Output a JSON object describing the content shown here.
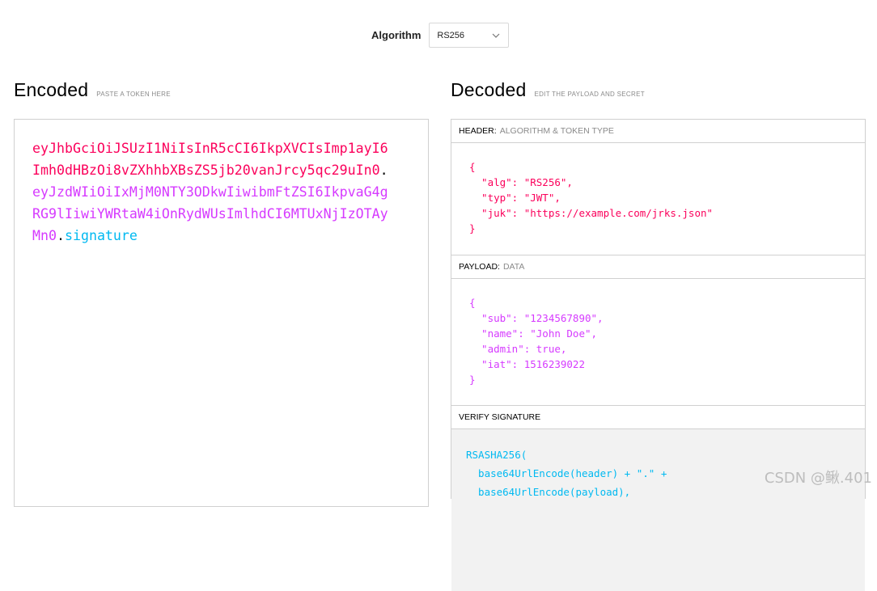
{
  "algorithm": {
    "label": "Algorithm",
    "selected": "RS256"
  },
  "encoded": {
    "title": "Encoded",
    "hint": "PASTE A TOKEN HERE",
    "token_header": "eyJhbGciOiJSUzI1NiIsInR5cCI6IkpXVCIsImp1ayI6Imh0dHBzOi8vZXhhbXBsZS5jb20vanJrcy5qc29uIn0",
    "token_payload": "eyJzdWIiOiIxMjM0NTY3ODkwIiwibmFtZSI6IkpvaG4gRG9lIiwiYWRtaW4iOnRydWUsImlhdCI6MTUxNjIzOTAyMn0",
    "token_signature": "signature",
    "dot": "."
  },
  "decoded": {
    "title": "Decoded",
    "hint": "EDIT THE PAYLOAD AND SECRET",
    "header_panel": {
      "label": "HEADER:",
      "sub": "ALGORITHM & TOKEN TYPE",
      "lines": [
        "{",
        "  \"alg\": \"RS256\",",
        "  \"typ\": \"JWT\",",
        "  \"juk\": \"https://example.com/jrks.json\"",
        "}"
      ]
    },
    "payload_panel": {
      "label": "PAYLOAD:",
      "sub": "DATA",
      "lines": [
        "{",
        "  \"sub\": \"1234567890\",",
        "  \"name\": \"John Doe\",",
        "  \"admin\": true,",
        "  \"iat\": 1516239022",
        "}"
      ]
    },
    "verify_panel": {
      "label": "VERIFY SIGNATURE",
      "lines": [
        "RSASHA256(",
        "  base64UrlEncode(header) + \".\" +",
        "  base64UrlEncode(payload),"
      ]
    }
  },
  "watermark": "CSDN @鳅.401",
  "colors": {
    "header": "#fb015b",
    "payload": "#d63aff",
    "signature": "#00b9f1"
  },
  "icons": {
    "select_chevron": "chevron-down-icon"
  }
}
